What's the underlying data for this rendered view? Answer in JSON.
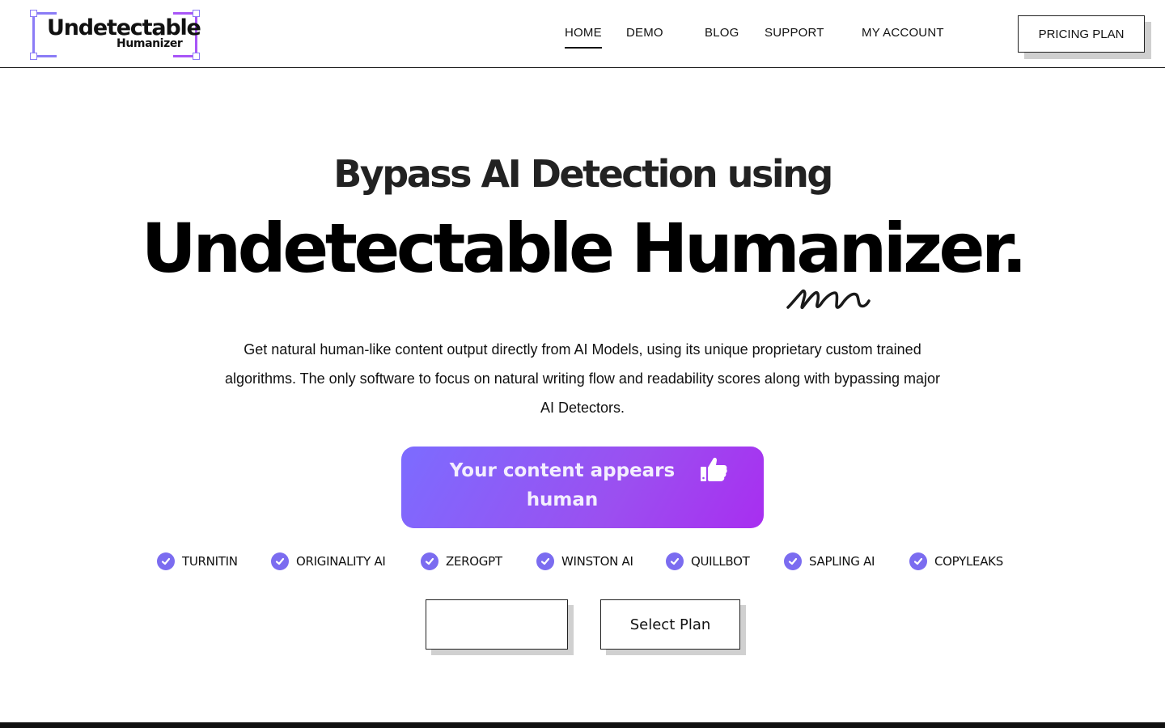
{
  "logo": {
    "line1": "Undetectable",
    "line2": "Humanizer"
  },
  "nav": [
    {
      "label": "HOME",
      "active": true
    },
    {
      "label": "DEMO"
    },
    {
      "label": "BLOG"
    },
    {
      "label": "SUPPORT"
    },
    {
      "label": "MY ACCOUNT"
    }
  ],
  "header": {
    "pricing_label": "PRICING PLAN"
  },
  "hero": {
    "subtitle": "Bypass AI Detection using",
    "title": "Undetectable Humanizer.",
    "description": "Get natural human-like content output directly from AI Models, using its unique proprietary custom trained algorithms. The only software to focus on natural writing flow and readability scores along with bypassing major AI Detectors."
  },
  "cta": {
    "label": "Your content appears human",
    "icon": "thumbs-up-icon"
  },
  "detectors": [
    "TURNITIN",
    "ORIGINALITY AI",
    "ZEROGPT",
    "WINSTON AI",
    "QUILLBOT",
    "SAPLING AI",
    "COPYLEAKS"
  ],
  "actions": {
    "left_label": "",
    "select_plan_label": "Select Plan"
  },
  "colors": {
    "accent": "#7b6cf0",
    "gradient_start": "#7c6cff",
    "gradient_end": "#a82ef0"
  }
}
